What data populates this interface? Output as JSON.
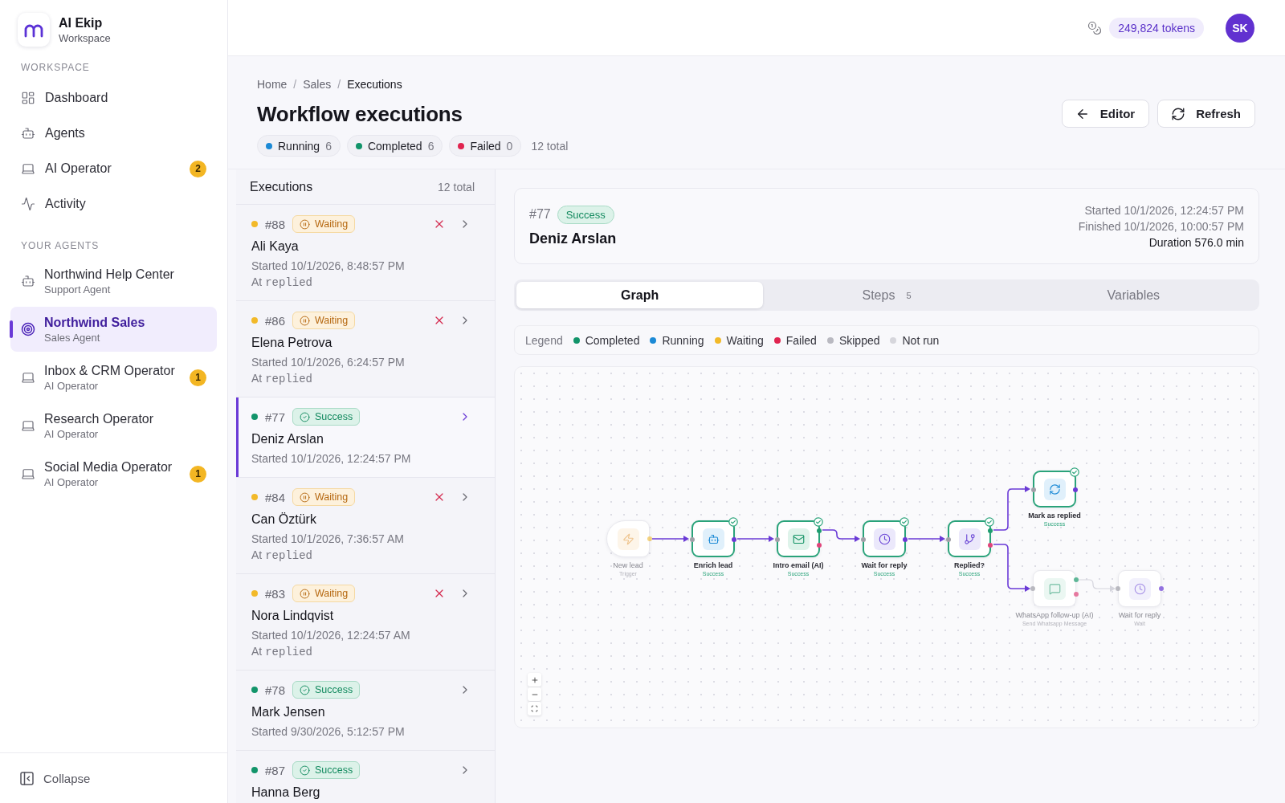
{
  "sidebar": {
    "brand": {
      "name": "AI Ekip",
      "subtitle": "Workspace"
    },
    "workspace": {
      "title": "WORKSPACE",
      "items": [
        {
          "label": "Dashboard",
          "kind": "dashboard",
          "selected": false
        },
        {
          "label": "Agents",
          "kind": "agents",
          "selected": false
        },
        {
          "label": "AI Operator",
          "kind": "operator",
          "badge": "2",
          "selected": false
        },
        {
          "label": "Activity",
          "kind": "activity",
          "selected": false
        }
      ]
    },
    "agents": {
      "title": "YOUR AGENTS",
      "items": [
        {
          "name": "Northwind Help Center",
          "role": "Support Agent",
          "kind": "support",
          "selected": false
        },
        {
          "name": "Northwind Sales",
          "role": "Sales Agent",
          "kind": "sales",
          "selected": true
        },
        {
          "name": "Inbox & CRM Operator",
          "role": "AI Operator",
          "kind": "operator",
          "badge": "1",
          "selected": false
        },
        {
          "name": "Research Operator",
          "role": "AI Operator",
          "kind": "operator",
          "selected": false
        },
        {
          "name": "Social Media Operator",
          "role": "AI Operator",
          "kind": "operator",
          "badge": "1",
          "selected": false
        }
      ]
    },
    "collapse": "Collapse"
  },
  "topbar": {
    "tokens": "249,824 tokens",
    "avatar": "SK"
  },
  "page": {
    "breadcrumb": [
      {
        "label": "Home",
        "kind": "link"
      },
      {
        "label": "/",
        "kind": "separator"
      },
      {
        "label": "Sales",
        "kind": "link"
      },
      {
        "label": "/",
        "kind": "separator"
      },
      {
        "label": "Executions",
        "kind": "current"
      }
    ],
    "title": "Workflow executions",
    "stats": [
      {
        "label": "Running",
        "count": "6",
        "color": "#1c8ad6"
      },
      {
        "label": "Completed",
        "count": "6",
        "color": "#12946a"
      },
      {
        "label": "Failed",
        "count": "0",
        "color": "#e0244f"
      }
    ],
    "total": "12 total",
    "actions": [
      {
        "label": "Editor",
        "kind": "back"
      },
      {
        "label": "Refresh",
        "kind": "refresh"
      }
    ]
  },
  "executions": {
    "title": "Executions",
    "total": "12 total",
    "rows": [
      {
        "id": "#88",
        "kind": "waiting",
        "status_label": "Waiting",
        "name": "Ali Kaya",
        "started": "Started 10/1/2026, 8:48:57 PM",
        "at": "At",
        "step": "replied",
        "cancellable": true,
        "selected": false
      },
      {
        "id": "#86",
        "kind": "waiting",
        "status_label": "Waiting",
        "name": "Elena Petrova",
        "started": "Started 10/1/2026, 6:24:57 PM",
        "at": "At",
        "step": "replied",
        "cancellable": true,
        "selected": false
      },
      {
        "id": "#77",
        "kind": "success",
        "status_label": "Success",
        "name": "Deniz Arslan",
        "started": "Started 10/1/2026, 12:24:57 PM",
        "cancellable": false,
        "selected": true
      },
      {
        "id": "#84",
        "kind": "waiting",
        "status_label": "Waiting",
        "name": "Can Öztürk",
        "started": "Started 10/1/2026, 7:36:57 AM",
        "at": "At",
        "step": "replied",
        "cancellable": true,
        "selected": false
      },
      {
        "id": "#83",
        "kind": "waiting",
        "status_label": "Waiting",
        "name": "Nora Lindqvist",
        "started": "Started 10/1/2026, 12:24:57 AM",
        "at": "At",
        "step": "replied",
        "cancellable": true,
        "selected": false
      },
      {
        "id": "#78",
        "kind": "success",
        "status_label": "Success",
        "name": "Mark Jensen",
        "started": "Started 9/30/2026, 5:12:57 PM",
        "cancellable": false,
        "selected": false
      },
      {
        "id": "#87",
        "kind": "success",
        "status_label": "Success",
        "name": "Hanna Berg",
        "cancellable": false,
        "selected": false
      }
    ]
  },
  "detail": {
    "id": "#77",
    "kind": "success",
    "status_label": "Success",
    "name": "Deniz Arslan",
    "started": "Started 10/1/2026, 12:24:57 PM",
    "finished": "Finished 10/1/2026, 10:00:57 PM",
    "duration": "Duration 576.0 min",
    "tabs": [
      {
        "label": "Graph",
        "selected": true
      },
      {
        "label": "Steps",
        "count": "5",
        "selected": false
      },
      {
        "label": "Variables",
        "selected": false
      }
    ],
    "legend": {
      "title": "Legend",
      "items": [
        {
          "label": "Completed",
          "color": "#12946a"
        },
        {
          "label": "Running",
          "color": "#1c8ad6"
        },
        {
          "label": "Waiting",
          "color": "#f2b929"
        },
        {
          "label": "Failed",
          "color": "#e0244f"
        },
        {
          "label": "Skipped",
          "color": "#b9b9c1"
        },
        {
          "label": "Not run",
          "color": "#d6d6dc"
        }
      ]
    },
    "graph": {
      "flow": [
        {
          "label": "New lead",
          "sublabel": "Trigger",
          "kind": "trigger",
          "completed": false,
          "children": [
            {
              "label": "Enrich lead",
              "sublabel": "Success",
              "kind": "agent",
              "completed": true,
              "edge": {
                "kind": "out",
                "active": true
              },
              "children": [
                {
                  "label": "Intro email (AI)",
                  "sublabel": "Success",
                  "kind": "email",
                  "completed": true,
                  "edge": {
                    "kind": "out",
                    "active": true
                  },
                  "children": [
                    {
                      "label": "Wait for reply",
                      "sublabel": "Success",
                      "kind": "wait",
                      "completed": true,
                      "edge": {
                        "kind": "success",
                        "active": true
                      },
                      "children": [
                        {
                          "label": "Replied?",
                          "sublabel": "Success",
                          "kind": "condition",
                          "completed": true,
                          "edge": {
                            "kind": "out",
                            "active": true
                          },
                          "children": [
                            {
                              "label": "Mark as replied",
                              "sublabel": "Success",
                              "kind": "action",
                              "completed": true,
                              "edge": {
                                "kind": "success",
                                "active": true
                              }
                            },
                            {
                              "label": "WhatsApp follow-up (AI)",
                              "sublabel": "Send Whatsapp Message",
                              "kind": "message",
                              "completed": false,
                              "edge": {
                                "kind": "failure",
                                "active": true
                              },
                              "children": [
                                {
                                  "label": "Wait for reply",
                                  "sublabel": "Wait",
                                  "kind": "wait",
                                  "completed": false,
                                  "edge": {
                                    "kind": "success",
                                    "active": false
                                  }
                                }
                              ]
                            }
                          ]
                        }
                      ]
                    }
                  ]
                }
              ]
            }
          ]
        }
      ]
    }
  }
}
